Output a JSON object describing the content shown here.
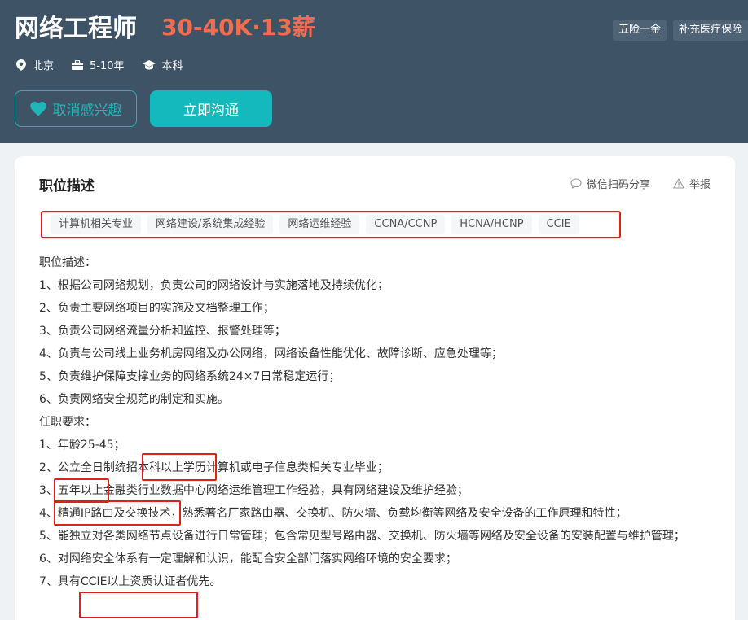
{
  "job": {
    "title": "网络工程师",
    "salary": "30-40K·13薪",
    "benefits": [
      "五险一金",
      "补充医疗保险"
    ],
    "meta": {
      "city": "北京",
      "experience": "5-10年",
      "degree": "本科"
    }
  },
  "buttons": {
    "interest": "取消感兴趣",
    "chat": "立即沟通"
  },
  "section": {
    "title": "职位描述",
    "share": "微信扫码分享",
    "report": "举报"
  },
  "tags": [
    "计算机相关专业",
    "网络建设/系统集成经验",
    "网络运维经验",
    "CCNA/CCNP",
    "HCNA/HCNP",
    "CCIE"
  ],
  "description": [
    "职位描述：",
    "1、根据公司网络规划，负责公司的网络设计与实施落地及持续优化；",
    "2、负责主要网络项目的实施及文档整理工作；",
    "3、负责公司网络流量分析和监控、报警处理等；",
    "4、负责与公司线上业务机房网络及办公网络，网络设备性能优化、故障诊断、应急处理等；",
    "5、负责维护保障支撑业务的网络系统24×7日常稳定运行；",
    "6、负责网络安全规范的制定和实施。",
    "任职要求：",
    "1、年龄25-45；",
    "2、公立全日制统招本科以上学历计算机或电子信息类相关专业毕业；",
    "3、五年以上金融类行业数据中心网络运维管理工作经验，具有网络建设及维护经验；",
    "4、精通IP路由及交换技术，熟悉著名厂家路由器、交换机、防火墙、负载均衡等网络及安全设备的工作原理和特性；",
    "5、能独立对各类网络节点设备进行日常管理；包含常见型号路由器、交换机、防火墙等网络及安全设备的安装配置与维护管理；",
    "6、对网络安全体系有一定理解和认识，能配合安全部门落实网络环境的安全要求；",
    "7、具有CCIE以上资质认证者优先。"
  ]
}
